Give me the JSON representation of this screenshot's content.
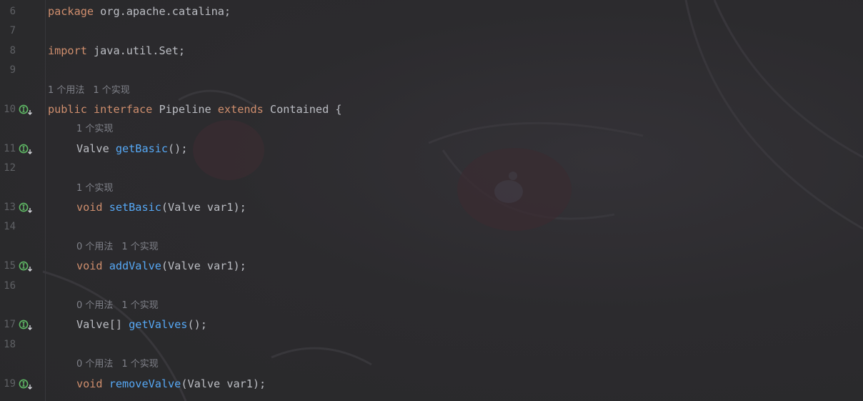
{
  "editor": {
    "lines": [
      {
        "type": "code",
        "num": "6",
        "indent": false,
        "tokens": [
          {
            "kind": "kw",
            "text": "package"
          },
          {
            "kind": "tx",
            "text": " org.apache.catalina;"
          }
        ]
      },
      {
        "type": "code",
        "num": "7",
        "indent": false,
        "tokens": []
      },
      {
        "type": "code",
        "num": "8",
        "indent": false,
        "tokens": [
          {
            "kind": "kw",
            "text": "import"
          },
          {
            "kind": "tx",
            "text": " java.util.Set;"
          }
        ]
      },
      {
        "type": "code",
        "num": "9",
        "indent": false,
        "tokens": []
      },
      {
        "type": "hint",
        "indent": false,
        "items": [
          "1 个用法",
          "1 个实现"
        ]
      },
      {
        "type": "code",
        "num": "10",
        "icon": true,
        "indent": false,
        "tokens": [
          {
            "kind": "kw",
            "text": "public"
          },
          {
            "kind": "tx",
            "text": " "
          },
          {
            "kind": "kw",
            "text": "interface"
          },
          {
            "kind": "tx",
            "text": " Pipeline "
          },
          {
            "kind": "kw",
            "text": "extends"
          },
          {
            "kind": "tx",
            "text": " Contained {"
          }
        ]
      },
      {
        "type": "hint",
        "indent": true,
        "items": [
          "1 个实现"
        ]
      },
      {
        "type": "code",
        "num": "11",
        "icon": true,
        "indent": true,
        "tokens": [
          {
            "kind": "tx",
            "text": "Valve "
          },
          {
            "kind": "fn",
            "text": "getBasic"
          },
          {
            "kind": "tx",
            "text": "();"
          }
        ]
      },
      {
        "type": "code",
        "num": "12",
        "indent": true,
        "tokens": []
      },
      {
        "type": "hint",
        "indent": true,
        "items": [
          "1 个实现"
        ]
      },
      {
        "type": "code",
        "num": "13",
        "icon": true,
        "indent": true,
        "tokens": [
          {
            "kind": "kw",
            "text": "void"
          },
          {
            "kind": "tx",
            "text": " "
          },
          {
            "kind": "fn",
            "text": "setBasic"
          },
          {
            "kind": "tx",
            "text": "(Valve var1);"
          }
        ]
      },
      {
        "type": "code",
        "num": "14",
        "indent": true,
        "tokens": []
      },
      {
        "type": "hint",
        "indent": true,
        "items": [
          "0 个用法",
          "1 个实现"
        ]
      },
      {
        "type": "code",
        "num": "15",
        "icon": true,
        "indent": true,
        "tokens": [
          {
            "kind": "kw",
            "text": "void"
          },
          {
            "kind": "tx",
            "text": " "
          },
          {
            "kind": "fn",
            "text": "addValve"
          },
          {
            "kind": "tx",
            "text": "(Valve var1);"
          }
        ]
      },
      {
        "type": "code",
        "num": "16",
        "indent": true,
        "tokens": []
      },
      {
        "type": "hint",
        "indent": true,
        "items": [
          "0 个用法",
          "1 个实现"
        ]
      },
      {
        "type": "code",
        "num": "17",
        "icon": true,
        "indent": true,
        "tokens": [
          {
            "kind": "tx",
            "text": "Valve[] "
          },
          {
            "kind": "fn",
            "text": "getValves"
          },
          {
            "kind": "tx",
            "text": "();"
          }
        ]
      },
      {
        "type": "code",
        "num": "18",
        "indent": true,
        "tokens": []
      },
      {
        "type": "hint",
        "indent": true,
        "items": [
          "0 个用法",
          "1 个实现"
        ]
      },
      {
        "type": "code",
        "num": "19",
        "icon": true,
        "indent": true,
        "tokens": [
          {
            "kind": "kw",
            "text": "void"
          },
          {
            "kind": "tx",
            "text": " "
          },
          {
            "kind": "fn",
            "text": "removeValve"
          },
          {
            "kind": "tx",
            "text": "(Valve var1);"
          }
        ]
      }
    ]
  },
  "icons": {
    "gutter_marker": "implemented-interface-icon"
  },
  "colors": {
    "background": "#2b2b2d",
    "keyword": "#cf8e6d",
    "method": "#56a8f5",
    "text": "#bcbec4",
    "line_number": "#5f6165",
    "hint": "#80828a",
    "gutter_icon": "#5fb865"
  }
}
